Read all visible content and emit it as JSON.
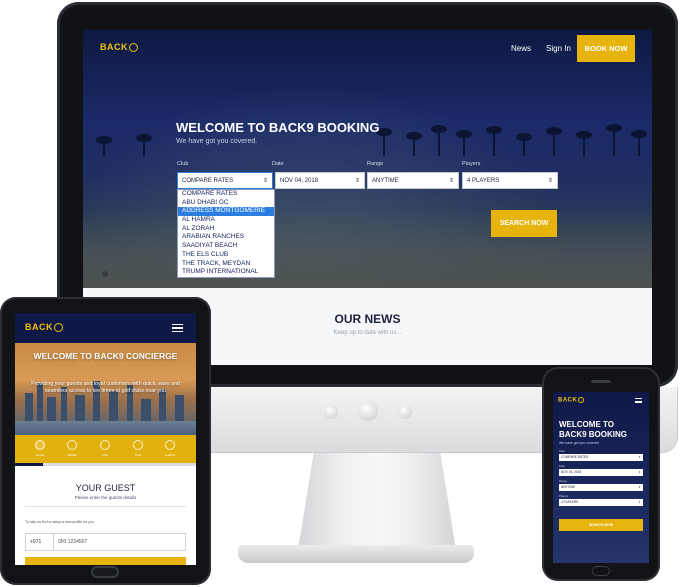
{
  "desktop": {
    "logo": "BACK",
    "nav": {
      "news": "News",
      "sign_in": "Sign In",
      "book_now": "BOOK NOW"
    },
    "hero": {
      "title": "WELCOME TO BACK9 BOOKING",
      "subtitle": "We have got you covered."
    },
    "form": {
      "club_label": "Club",
      "club_value": "COMPARE RATES",
      "date_label": "Date",
      "date_value": "NOV 04, 2018",
      "range_label": "Range",
      "range_value": "ANYTIME",
      "players_label": "Players",
      "players_value": "4 PLAYERS",
      "search_button": "SEARCH NOW"
    },
    "club_options": [
      "COMPARE RATES",
      "ABU DHABI GC",
      "ADDRESS MONTGOMERIE",
      "AL HAMRA",
      "AL ZORAH",
      "ARABIAN RANCHES",
      "SAADIYAT BEACH",
      "THE ELS CLUB",
      "THE TRACK, MEYDAN",
      "TRUMP INTERNATIONAL"
    ],
    "highlighted_option": "ADDRESS MONTGOMERIE",
    "news": {
      "title": "OUR NEWS",
      "subtitle": "Keep up to date with us..."
    }
  },
  "tablet": {
    "logo": "BACK",
    "hero_title": "WELCOME TO BACK9 CONCIERGE",
    "hero_text": "Providing your guests and loyal customers with quick, easy and seamless access to tee times at golf clubs near you",
    "steps": [
      "1",
      "2",
      "3",
      "4",
      "5"
    ],
    "step_labels": [
      "Guest",
      "Details",
      "Club",
      "Time",
      "Confirm"
    ],
    "section_title": "YOUR GUEST",
    "section_subtitle": "Please enter the guests details",
    "help_text": "To help us find or setup a new profile for you",
    "phone_code": "+971",
    "phone_placeholder": "050 1234567"
  },
  "phone": {
    "logo": "BACK",
    "title": "WELCOME TO BACK9 BOOKING",
    "subtitle": "We have got you covered.",
    "club_label": "Club",
    "club_value": "COMPARE RATES",
    "date_label": "Date",
    "date_value": "NOV 04, 2018",
    "range_label": "Range",
    "range_value": "ANYTIME",
    "players_label": "Players",
    "players_value": "4 PLAYERS",
    "search_button": "SEARCH NOW"
  },
  "colors": {
    "navy": "#0f1846",
    "gold": "#e6b40c",
    "highlight": "#2b7de0"
  }
}
